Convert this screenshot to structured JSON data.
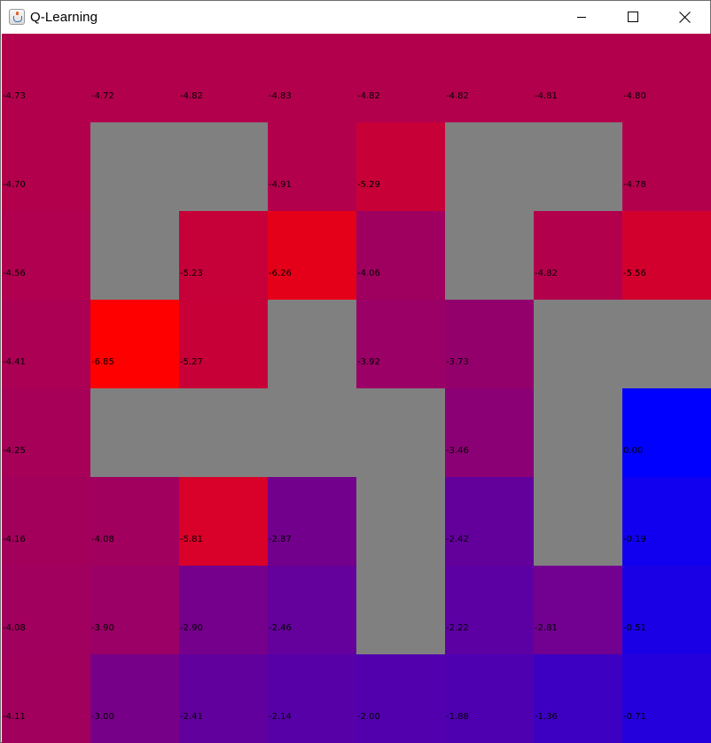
{
  "window": {
    "title": "Q-Learning",
    "controls": [
      "minimize",
      "maximize",
      "close"
    ]
  },
  "colors": {
    "wall": "#808080"
  },
  "grid": {
    "rows": 8,
    "cols": 8,
    "cells": [
      [
        {
          "value": "-4.73",
          "color": "#b3004c"
        },
        {
          "value": "-4.72",
          "color": "#b3004c"
        },
        {
          "value": "-4.82",
          "color": "#b3004c"
        },
        {
          "value": "-4.83",
          "color": "#b3004c"
        },
        {
          "value": "-4.82",
          "color": "#b3004c"
        },
        {
          "value": "-4.82",
          "color": "#b3004c"
        },
        {
          "value": "-4.81",
          "color": "#b3004c"
        },
        {
          "value": "-4.80",
          "color": "#b3004c"
        }
      ],
      [
        {
          "value": "-4.70",
          "color": "#b3004c"
        },
        {
          "wall": true
        },
        {
          "wall": true
        },
        {
          "value": "-4.91",
          "color": "#b3004c"
        },
        {
          "value": "-5.29",
          "color": "#c70038"
        },
        {
          "wall": true
        },
        {
          "wall": true
        },
        {
          "value": "-4.78",
          "color": "#b3004c"
        }
      ],
      [
        {
          "value": "-4.56",
          "color": "#b0004f"
        },
        {
          "wall": true
        },
        {
          "value": "-5.23",
          "color": "#c60039"
        },
        {
          "value": "-6.26",
          "color": "#e50019"
        },
        {
          "value": "-4.06",
          "color": "#9f0060"
        },
        {
          "wall": true
        },
        {
          "value": "-4.82",
          "color": "#b3004c"
        },
        {
          "value": "-5.56",
          "color": "#d2002d"
        }
      ],
      [
        {
          "value": "-4.41",
          "color": "#ab0054"
        },
        {
          "value": "-6.85",
          "color": "#ff0000"
        },
        {
          "value": "-5.27",
          "color": "#c70038"
        },
        {
          "wall": true
        },
        {
          "value": "-3.92",
          "color": "#9a0065"
        },
        {
          "value": "-3.73",
          "color": "#93006c"
        },
        {
          "wall": true
        },
        {
          "wall": true
        }
      ],
      [
        {
          "value": "-4.25",
          "color": "#a60059"
        },
        {
          "wall": true
        },
        {
          "wall": true
        },
        {
          "wall": true
        },
        {
          "wall": true
        },
        {
          "value": "-3.46",
          "color": "#8b0074"
        },
        {
          "wall": true
        },
        {
          "value": "0.00",
          "color": "#0000ff"
        }
      ],
      [
        {
          "value": "-4.16",
          "color": "#a3005c"
        },
        {
          "value": "-4.08",
          "color": "#a1005e"
        },
        {
          "value": "-5.81",
          "color": "#d9002a"
        },
        {
          "value": "-2.87",
          "color": "#73008c"
        },
        {
          "wall": true
        },
        {
          "value": "-2.42",
          "color": "#63009c"
        },
        {
          "wall": true
        },
        {
          "value": "-0.19",
          "color": "#1000ef"
        }
      ],
      [
        {
          "value": "-4.08",
          "color": "#a1005e"
        },
        {
          "value": "-3.90",
          "color": "#9a0065"
        },
        {
          "value": "-2.90",
          "color": "#74008b"
        },
        {
          "value": "-2.46",
          "color": "#64009b"
        },
        {
          "wall": true
        },
        {
          "value": "-2.22",
          "color": "#5c00a3"
        },
        {
          "value": "-2.81",
          "color": "#720091"
        },
        {
          "value": "-0.51",
          "color": "#1a00e5"
        }
      ],
      [
        {
          "value": "-4.11",
          "color": "#a2005d"
        },
        {
          "value": "-3.00",
          "color": "#770088"
        },
        {
          "value": "-2.41",
          "color": "#62009d"
        },
        {
          "value": "-2.14",
          "color": "#5700a8"
        },
        {
          "value": "-2.00",
          "color": "#5200ad"
        },
        {
          "value": "-1.88",
          "color": "#4e00b1"
        },
        {
          "value": "-1.36",
          "color": "#3d00c2"
        },
        {
          "value": "-0.71",
          "color": "#2300dc"
        }
      ]
    ]
  }
}
